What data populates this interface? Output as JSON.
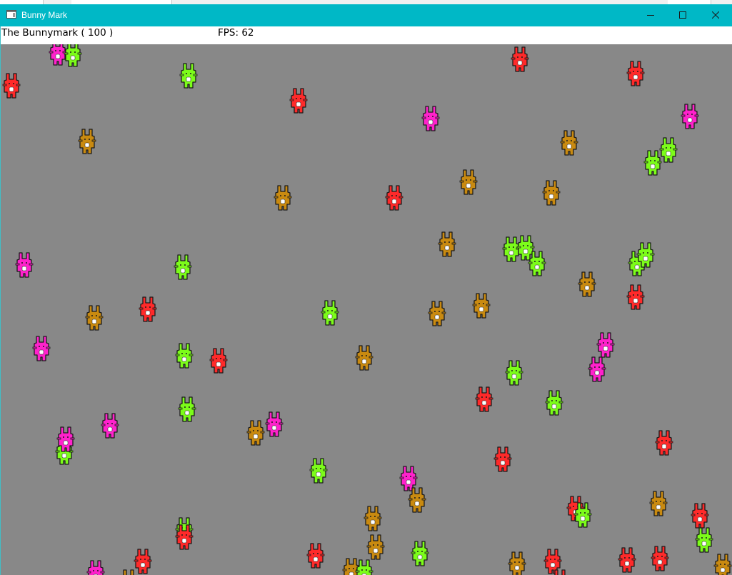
{
  "window": {
    "title": "Bunny Mark",
    "icon": "app-window-icon",
    "controls": [
      "minimize-icon",
      "maximize-icon",
      "close-icon"
    ],
    "titlebar_color": "#00b8c6"
  },
  "hud": {
    "title": "The Bunnymark ( 100 )",
    "fps_label": "FPS: 62"
  },
  "scene": {
    "background": "#888888",
    "palette": {
      "green": "#7cfc1a",
      "red": "#ff2a2a",
      "magenta": "#ff22cc",
      "orange": "#c98a10"
    },
    "bunnies": [
      {
        "color": "magenta"
      },
      {
        "color": "green"
      },
      {
        "color": "red"
      },
      {
        "color": "green"
      },
      {
        "color": "red"
      },
      {
        "color": "red"
      },
      {
        "color": "red"
      },
      {
        "color": "magenta"
      },
      {
        "color": "magenta"
      },
      {
        "color": "orange"
      },
      {
        "color": "green"
      },
      {
        "color": "green"
      },
      {
        "color": "orange"
      },
      {
        "color": "red"
      },
      {
        "color": "orange"
      },
      {
        "color": "orange"
      },
      {
        "color": "orange"
      },
      {
        "color": "orange"
      },
      {
        "color": "magenta"
      },
      {
        "color": "green"
      },
      {
        "color": "green"
      },
      {
        "color": "green"
      },
      {
        "color": "green"
      },
      {
        "color": "green"
      },
      {
        "color": "green"
      },
      {
        "color": "orange"
      },
      {
        "color": "red"
      },
      {
        "color": "orange"
      },
      {
        "color": "red"
      },
      {
        "color": "green"
      },
      {
        "color": "orange"
      },
      {
        "color": "orange"
      },
      {
        "color": "magenta"
      },
      {
        "color": "green"
      },
      {
        "color": "red"
      },
      {
        "color": "orange"
      },
      {
        "color": "magenta"
      },
      {
        "color": "magenta"
      },
      {
        "color": "green"
      },
      {
        "color": "green"
      },
      {
        "color": "red"
      },
      {
        "color": "green"
      },
      {
        "color": "magenta"
      },
      {
        "color": "green"
      },
      {
        "color": "magenta"
      },
      {
        "color": "orange"
      },
      {
        "color": "magenta"
      },
      {
        "color": "red"
      },
      {
        "color": "red"
      },
      {
        "color": "green"
      },
      {
        "color": "magenta"
      },
      {
        "color": "orange"
      },
      {
        "color": "orange"
      },
      {
        "color": "red"
      },
      {
        "color": "green"
      },
      {
        "color": "green"
      },
      {
        "color": "red"
      },
      {
        "color": "green"
      },
      {
        "color": "orange"
      },
      {
        "color": "green"
      },
      {
        "color": "red"
      },
      {
        "color": "orange"
      },
      {
        "color": "orange"
      },
      {
        "color": "red"
      },
      {
        "color": "magenta"
      },
      {
        "color": "orange"
      },
      {
        "color": "red"
      },
      {
        "color": "orange"
      },
      {
        "color": "green"
      },
      {
        "color": "orange"
      },
      {
        "color": "red"
      },
      {
        "color": "red"
      },
      {
        "color": "red"
      },
      {
        "color": "red"
      }
    ]
  }
}
